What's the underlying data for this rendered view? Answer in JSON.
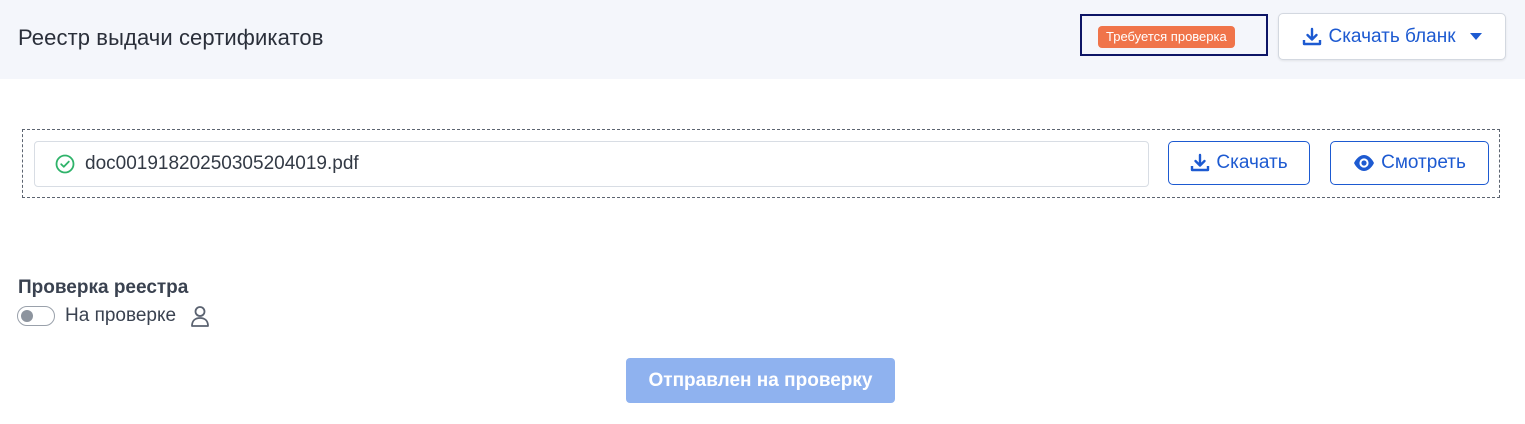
{
  "header": {
    "title": "Реестр выдачи сертификатов",
    "status_badge": "Требуется проверка",
    "download_template_label": "Скачать бланк"
  },
  "file": {
    "name": "doc00191820250305204019.pdf",
    "download_label": "Скачать",
    "view_label": "Смотреть"
  },
  "review": {
    "section_label": "Проверка реестра",
    "toggle_label": "На проверке",
    "toggle_on": false,
    "submit_label": "Отправлен на проверку"
  },
  "colors": {
    "accent": "#1d5ad1",
    "status_badge": "#f0744a",
    "success": "#2fb36a",
    "submit_disabled": "#8fb2ef"
  },
  "icons": [
    "download-icon",
    "chevron-down-icon",
    "check-circle-icon",
    "eye-icon",
    "user-icon"
  ]
}
